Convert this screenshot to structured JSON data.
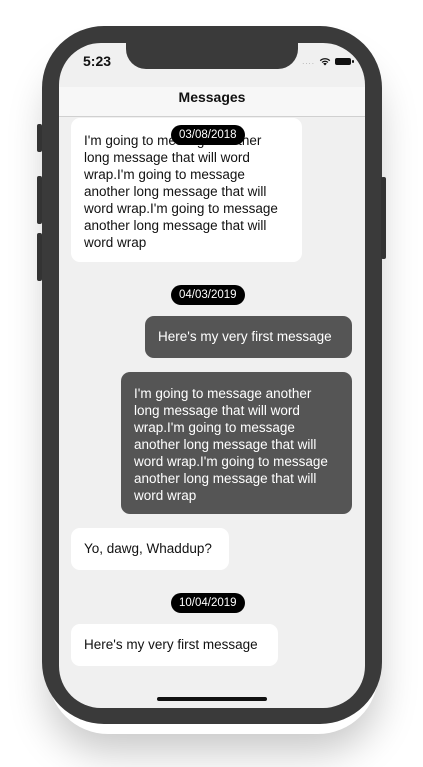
{
  "status_bar": {
    "time": "5:23",
    "signal_dots": "....",
    "wifi_icon": "wifi-icon",
    "battery_icon": "battery-icon"
  },
  "nav": {
    "title": "Messages"
  },
  "messages": [
    {
      "direction": "incoming",
      "text": "I'm going to message another long message that will word wrap.I'm going to message another long message that will word wrap.I'm going to message another long message that will word wrap"
    },
    {
      "direction": "outgoing",
      "text": "Here's my very first message"
    },
    {
      "direction": "outgoing",
      "text": "I'm going to message another long message that will word wrap.I'm going to message another long message that will word wrap.I'm going to message another long message that will word wrap"
    },
    {
      "direction": "incoming",
      "text": "Yo, dawg, Whaddup?"
    },
    {
      "direction": "incoming",
      "text": "Here's my very first message"
    }
  ],
  "date_separators": [
    "03/08/2018",
    "04/03/2019",
    "10/04/2019"
  ],
  "colors": {
    "incoming_bubble": "#ffffff",
    "outgoing_bubble": "#555555",
    "date_pill": "#000000",
    "background": "#f0f0f0",
    "device_frame": "#3a3a3a"
  }
}
